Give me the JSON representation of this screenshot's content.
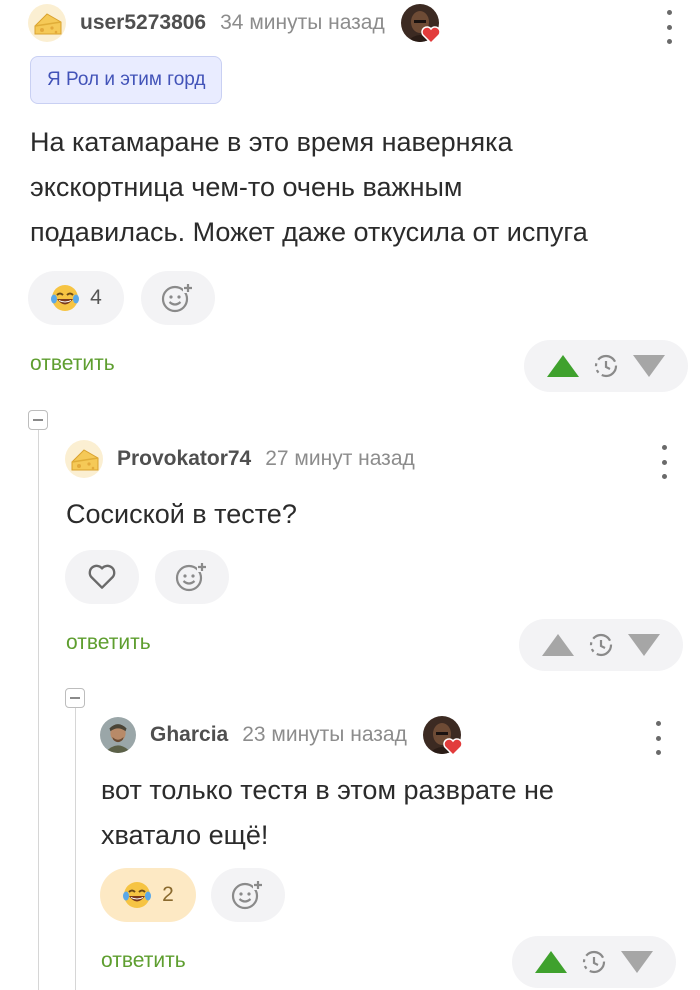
{
  "comments": [
    {
      "username": "user5273806",
      "time": "34 минуты назад",
      "tag": "Я Рол и этим горд",
      "text_lines": [
        "На катамаране в это время наверняка",
        "экскортница чем-то очень важным",
        "подавилась. Может даже откусила от испуга"
      ],
      "reaction_icon": "laughing-tears-emoji-icon",
      "reaction_count": "4",
      "reply_label": "ответить",
      "upvoted": true
    },
    {
      "username": "Provokator74",
      "time": "27 минут назад",
      "text_lines": [
        "Сосиской в тесте?"
      ],
      "reaction_icon": "heart-icon",
      "reply_label": "ответить",
      "upvoted": false
    },
    {
      "username": "Gharcia",
      "time": "23 минуты назад",
      "text_lines": [
        "вот только тестя в этом разврате не",
        "хватало ещё!"
      ],
      "reaction_icon": "laughing-tears-emoji-icon",
      "reaction_count": "2",
      "reply_label": "ответить",
      "upvoted": true
    }
  ],
  "colors": {
    "accent_green": "#3fa12d",
    "reply_green": "#5e9e2f",
    "tag_bg": "#e9ecff",
    "tag_text": "#4253b8",
    "active_reaction_bg": "#fde9c4"
  }
}
